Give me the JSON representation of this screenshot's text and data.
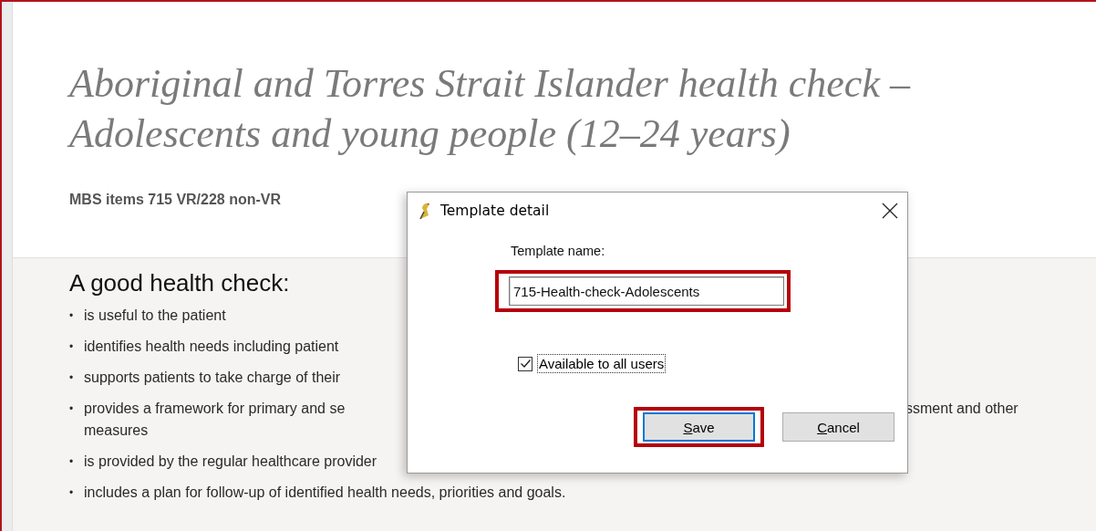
{
  "page": {
    "heading": "Aboriginal and Torres Strait Islander health check – Adolescents and young people (12–24 years)",
    "subtitle": "MBS items 715 VR/228 non-VR",
    "section_title": "A good health check:",
    "bullets": [
      {
        "marker": "•",
        "text": "is useful to the patient"
      },
      {
        "marker": "•",
        "text": "identifies health needs including patient"
      },
      {
        "marker": "•",
        "text": "supports patients to take charge of their"
      },
      {
        "marker": "•",
        "text": "provides a framework for primary and se",
        "text_after": "ssment and other",
        "continuation": "measures"
      },
      {
        "marker": "•",
        "text": "is provided by the regular healthcare provider"
      },
      {
        "marker": "•",
        "text": "includes a plan for follow-up of identified health needs, priorities and goals."
      }
    ]
  },
  "dialog": {
    "title": "Template detail",
    "field_label": "Template name:",
    "field": {
      "value": "715-Health-check-Adolescents",
      "highlighted": true
    },
    "checkbox": {
      "label": "Available to all users",
      "checked": true
    },
    "buttons": [
      {
        "label": "Save",
        "default": true,
        "highlighted": true
      },
      {
        "label": "Cancel",
        "default": false,
        "highlighted": false
      }
    ]
  }
}
